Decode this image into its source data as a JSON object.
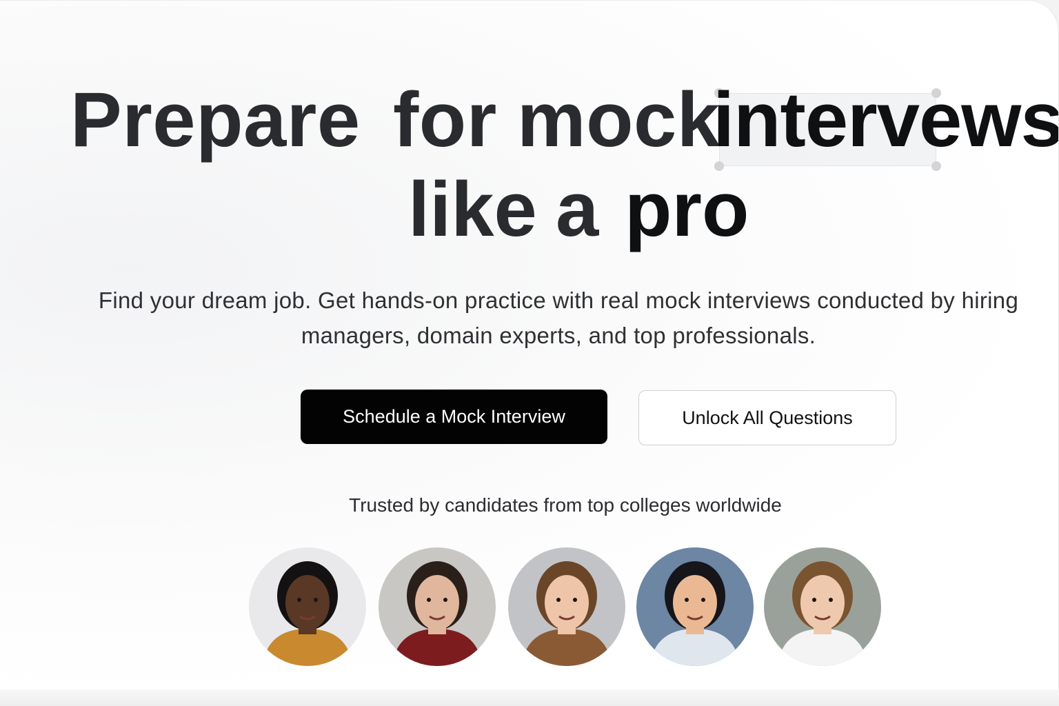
{
  "hero": {
    "line1_words": [
      "Prepare",
      "for",
      "mock",
      "intervews"
    ],
    "line2_words": [
      "like",
      "a",
      "pro"
    ]
  },
  "subtitle": {
    "line1": "Find your dream job. Get hands-on practice with real mock interviews conducted by hiring",
    "line2": "managers, domain experts, and top professionals."
  },
  "buttons": {
    "primary": "Schedule a Mock Interview",
    "secondary": "Unlock All Questions"
  },
  "trusted_text": "Trusted by candidates from top colleges worldwide",
  "avatars": [
    {
      "name": "avatar-1",
      "bg": "#e9e9eb",
      "skin": "#5a3826",
      "hair": "#141112",
      "shirt": "#c8892f"
    },
    {
      "name": "avatar-2",
      "bg": "#c9c7c4",
      "skin": "#e0b79d",
      "hair": "#2b1f1a",
      "shirt": "#7d1c1f"
    },
    {
      "name": "avatar-3",
      "bg": "#c2c3c6",
      "skin": "#eec5a8",
      "hair": "#6b4528",
      "shirt": "#8a5a34"
    },
    {
      "name": "avatar-4",
      "bg": "#6c86a4",
      "skin": "#eab993",
      "hair": "#15151a",
      "shirt": "#dfe6ee"
    },
    {
      "name": "avatar-5",
      "bg": "#9aa19a",
      "skin": "#efc9ae",
      "hair": "#7a5330",
      "shirt": "#f4f4f4"
    }
  ],
  "colors": {
    "primary_button": "#030303",
    "text": "#2a2b2e"
  }
}
